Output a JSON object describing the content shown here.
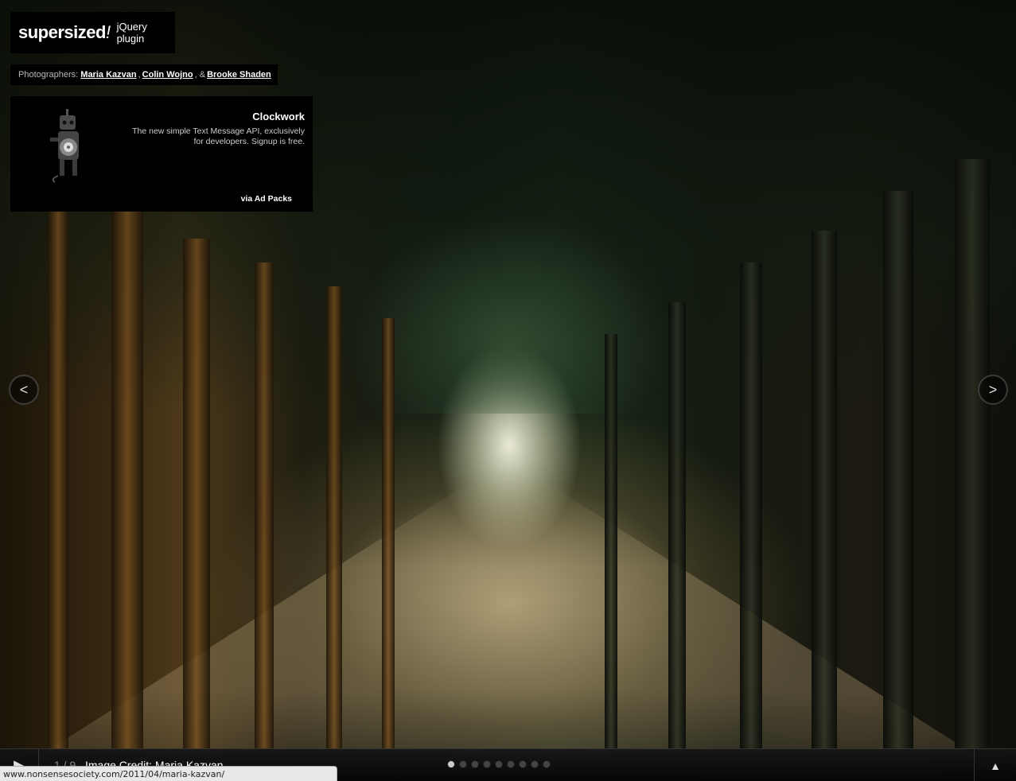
{
  "logo": {
    "main": "supersized",
    "bang": "!",
    "sub": "jQuery plugin"
  },
  "credits": {
    "prefix": "Photographers:",
    "photographers": [
      "Maria Kazvan",
      "Colin Wojno",
      "Brooke Shaden"
    ],
    "sep1": ",",
    "sep2": ", &"
  },
  "ad": {
    "title": "Clockwork",
    "description": "The new simple Text Message API, exclusively for developers. Signup is free.",
    "via": "via Ad Packs"
  },
  "nav": {
    "prev": "<",
    "next": ">"
  },
  "controls": {
    "play_icon": "play-icon",
    "counter": "1 / 9",
    "caption": "Image Credit: Maria Kazvan",
    "slide_count": 9,
    "active_slide": 1,
    "tray_icon": "tray-up-icon"
  },
  "status_url": "www.nonsensesociety.com/2011/04/maria-kazvan/",
  "colors": {
    "panel_bg": "#000000",
    "accent": "#ffffff"
  }
}
